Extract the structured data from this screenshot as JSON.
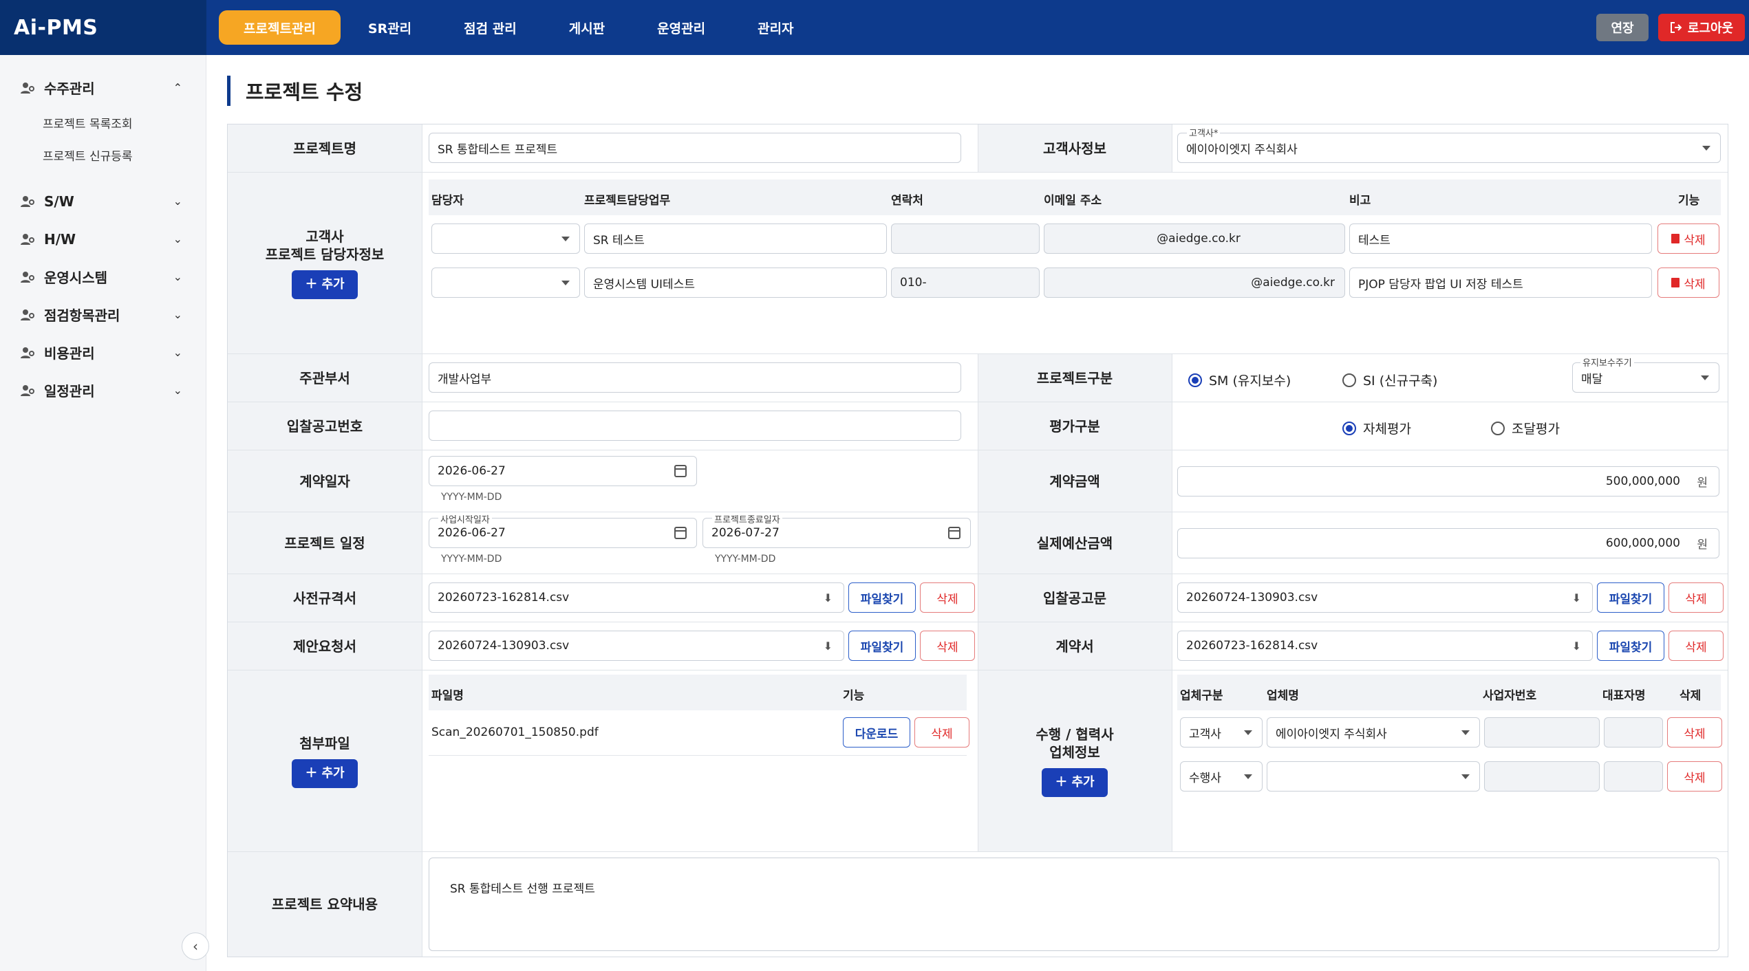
{
  "app": {
    "logo": "Ai-PMS"
  },
  "nav": [
    {
      "label": "프로젝트관리",
      "active": true
    },
    {
      "label": "SR관리"
    },
    {
      "label": "점검 관리"
    },
    {
      "label": "게시판"
    },
    {
      "label": "운영관리"
    },
    {
      "label": "관리자"
    }
  ],
  "top": {
    "extend": "연장",
    "logout": "로그아웃"
  },
  "sidebar": {
    "groups": [
      {
        "label": "수주관리",
        "expanded": true,
        "subs": [
          "프로젝트 목록조회",
          "프로젝트 신규등록"
        ]
      },
      {
        "label": "S/W"
      },
      {
        "label": "H/W"
      },
      {
        "label": "운영시스템"
      },
      {
        "label": "점검항목관리"
      },
      {
        "label": "비용관리"
      },
      {
        "label": "일정관리"
      }
    ]
  },
  "page": {
    "title": "프로젝트 수정"
  },
  "labels": {
    "project_name": "프로젝트명",
    "customer_info": "고객사정보",
    "contact_info": "고객사\n프로젝트 담당자정보",
    "dept": "주관부서",
    "project_type": "프로젝트구분",
    "bid_no": "입찰공고번호",
    "eval_type": "평가구분",
    "contract_date": "계약일자",
    "contract_amount": "계약금액",
    "schedule": "프로젝트 일정",
    "budget": "실제예산금액",
    "prespec": "사전규격서",
    "bid_notice": "입찰공고문",
    "rfp": "제안요청서",
    "contract": "계약서",
    "attach": "첨부파일",
    "partner": "수행 / 협력사\n업체정보",
    "summary": "프로젝트 요약내용",
    "add": "추가",
    "find": "파일찾기",
    "del": "삭제",
    "download": "다운로드",
    "won": "원",
    "date_hint": "YYYY-MM-DD"
  },
  "values": {
    "project_name": "SR 통합테스트 프로젝트",
    "customer_label": "고객사*",
    "customer": "에이아이엣지 주식회사",
    "dept": "개발사업부",
    "bid_no": "",
    "contract_date": "2026-06-27",
    "start_label": "사업시작일자",
    "start": "2026-06-27",
    "end_label": "프로젝트종료일자",
    "end": "2026-07-27",
    "contract_amount": "500,000,000",
    "budget": "600,000,000",
    "prespec_file": "20260723-162814.csv",
    "bid_notice_file": "20260724-130903.csv",
    "rfp_file": "20260724-130903.csv",
    "contract_file": "20260723-162814.csv",
    "summary": "SR 통합테스트 선행 프로젝트"
  },
  "project_type": {
    "options": [
      "SM (유지보수)",
      "SI (신규구축)"
    ],
    "selected": "SM (유지보수)",
    "cycle_label": "유지보수주기",
    "cycle": "매달"
  },
  "eval_type": {
    "options": [
      "자체평가",
      "조달평가"
    ],
    "selected": "자체평가"
  },
  "contacts": {
    "headers": [
      "담당자",
      "프로젝트담당업무",
      "연락처",
      "이메일 주소",
      "비고",
      "기능"
    ],
    "rows": [
      {
        "person": "",
        "task": "SR 테스트",
        "phone": "",
        "email": "@aiedge.co.kr",
        "note": "테스트"
      },
      {
        "person": "",
        "task": "운영시스템 UI테스트",
        "phone": "010-",
        "email": "@aiedge.co.kr",
        "note": "PJOP 담당자 팝업 UI 저장 테스트"
      }
    ]
  },
  "attachments": {
    "headers": [
      "파일명",
      "기능"
    ],
    "rows": [
      {
        "name": "Scan_20260701_150850.pdf"
      }
    ]
  },
  "partners": {
    "headers": [
      "업체구분",
      "업체명",
      "사업자번호",
      "대표자명",
      "삭제"
    ],
    "rows": [
      {
        "type": "고객사",
        "name": "에이아이엣지 주식회사",
        "bizno": "",
        "ceo": ""
      },
      {
        "type": "수행사",
        "name": "",
        "bizno": "",
        "ceo": ""
      }
    ]
  },
  "colors": {
    "primary": "#0d3a8c",
    "accent": "#f6a623",
    "danger": "#e02828",
    "button": "#1a3fb7"
  },
  "icons": [
    "person-group-icon",
    "chevron-up-icon",
    "chevron-down-icon",
    "calendar-icon",
    "download-icon",
    "trash-icon",
    "plus-icon",
    "logout-icon",
    "chevron-left-icon"
  ]
}
